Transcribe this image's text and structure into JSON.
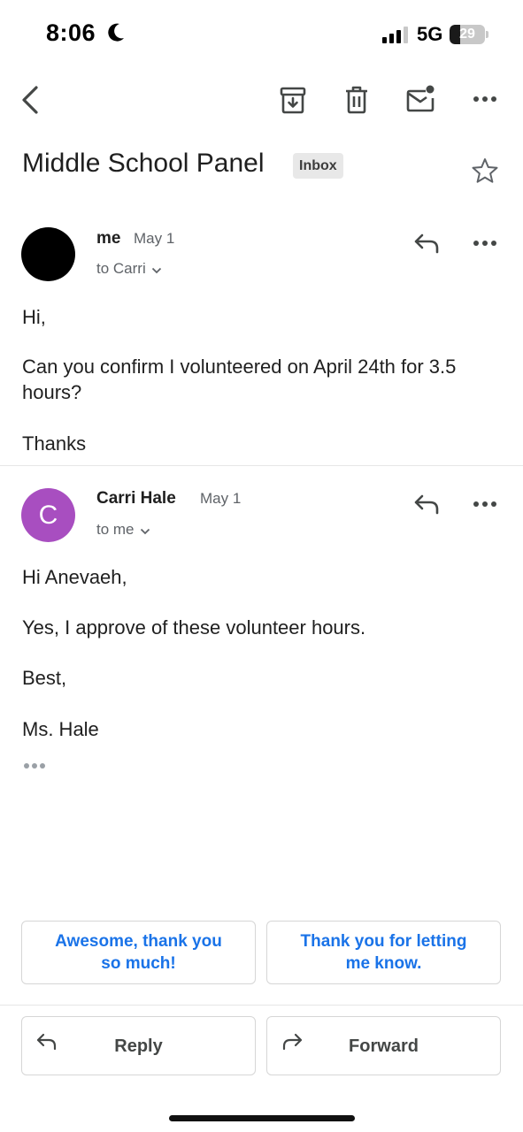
{
  "status_bar": {
    "time": "8:06",
    "network": "5G",
    "battery": "29",
    "battery_level": 0.29
  },
  "toolbar": {
    "back_icon": "chevron-left-icon",
    "archive_icon": "archive-icon",
    "delete_icon": "trash-icon",
    "unread_icon": "mark-unread-icon",
    "more_icon": "more-horizontal-icon"
  },
  "subject": {
    "title": "Middle School Panel",
    "label": "Inbox"
  },
  "messages": [
    {
      "sender": "me",
      "date": "May 1",
      "recipient": "to Carri",
      "avatar_color": "#000000",
      "avatar_letter": "",
      "body": [
        "Hi,",
        "Can you confirm I volunteered on April 24th for 3.5 hours?",
        "Thanks"
      ]
    },
    {
      "sender": "Carri Hale",
      "date": "May 1",
      "recipient": "to me",
      "avatar_color": "#a84ec0",
      "avatar_letter": "C",
      "body": [
        "Hi Anevaeh,",
        "Yes, I approve of these volunteer hours.",
        "Best,",
        "Ms. Hale"
      ]
    }
  ],
  "smart_replies": [
    "Awesome, thank you so much!",
    "Thank you for letting me know."
  ],
  "actions": {
    "reply": "Reply",
    "forward": "Forward"
  },
  "colors": {
    "accent": "#1a73e8",
    "text": "#1f1f1f",
    "muted": "#5f6368"
  }
}
